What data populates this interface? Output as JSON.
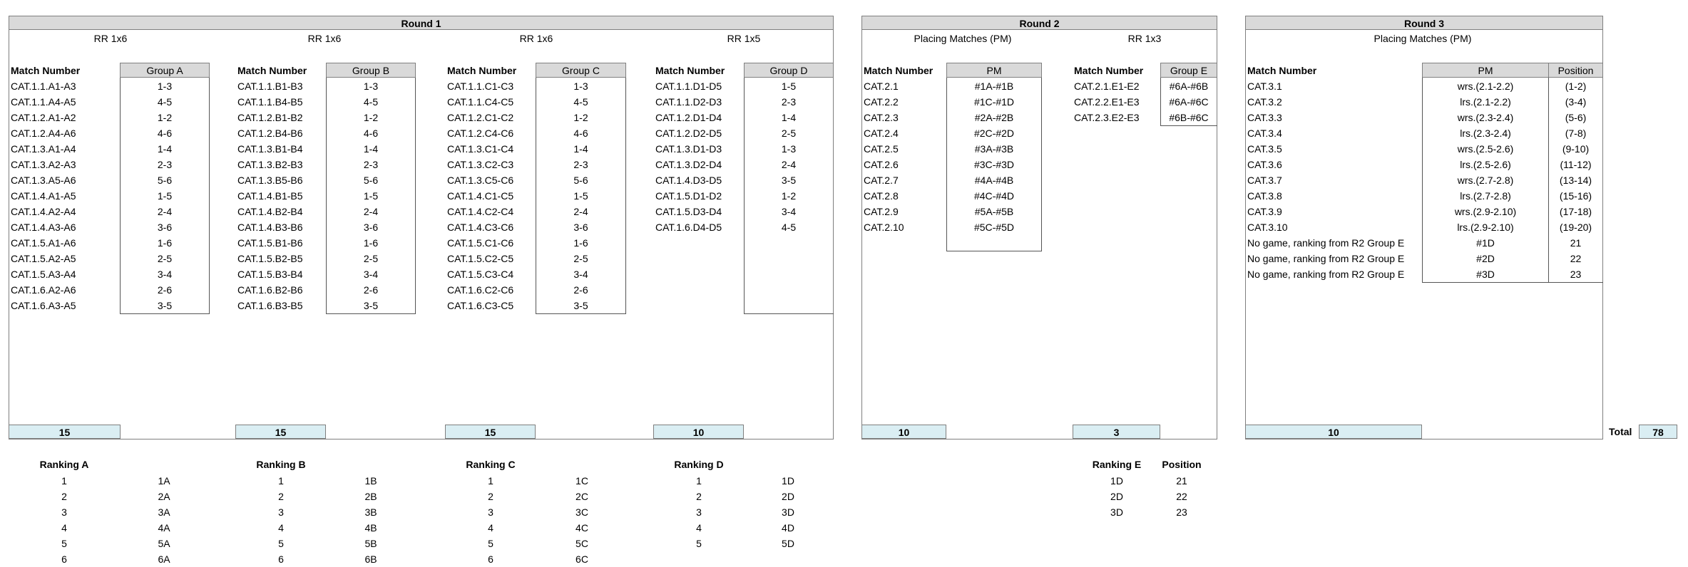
{
  "round1": {
    "title": "Round 1",
    "groups": [
      {
        "subtitle": "RR 1x6",
        "match_header": "Match Number",
        "group_header": "Group A",
        "matches": [
          "CAT.1.1.A1-A3",
          "CAT.1.1.A4-A5",
          "CAT.1.2.A1-A2",
          "CAT.1.2.A4-A6",
          "CAT.1.3.A1-A4",
          "CAT.1.3.A2-A3",
          "CAT.1.3.A5-A6",
          "CAT.1.4.A1-A5",
          "CAT.1.4.A2-A4",
          "CAT.1.4.A3-A6",
          "CAT.1.5.A1-A6",
          "CAT.1.5.A2-A5",
          "CAT.1.5.A3-A4",
          "CAT.1.6.A2-A6",
          "CAT.1.6.A3-A5"
        ],
        "pairs": [
          "1-3",
          "4-5",
          "1-2",
          "4-6",
          "1-4",
          "2-3",
          "5-6",
          "1-5",
          "2-4",
          "3-6",
          "1-6",
          "2-5",
          "3-4",
          "2-6",
          "3-5"
        ],
        "total": "15",
        "ranking_header": "Ranking A",
        "ranks": [
          "1",
          "2",
          "3",
          "4",
          "5",
          "6"
        ],
        "rank_codes": [
          "1A",
          "2A",
          "3A",
          "4A",
          "5A",
          "6A"
        ]
      },
      {
        "subtitle": "RR 1x6",
        "match_header": "Match Number",
        "group_header": "Group B",
        "matches": [
          "CAT.1.1.B1-B3",
          "CAT.1.1.B4-B5",
          "CAT.1.2.B1-B2",
          "CAT.1.2.B4-B6",
          "CAT.1.3.B1-B4",
          "CAT.1.3.B2-B3",
          "CAT.1.3.B5-B6",
          "CAT.1.4.B1-B5",
          "CAT.1.4.B2-B4",
          "CAT.1.4.B3-B6",
          "CAT.1.5.B1-B6",
          "CAT.1.5.B2-B5",
          "CAT.1.5.B3-B4",
          "CAT.1.6.B2-B6",
          "CAT.1.6.B3-B5"
        ],
        "pairs": [
          "1-3",
          "4-5",
          "1-2",
          "4-6",
          "1-4",
          "2-3",
          "5-6",
          "1-5",
          "2-4",
          "3-6",
          "1-6",
          "2-5",
          "3-4",
          "2-6",
          "3-5"
        ],
        "total": "15",
        "ranking_header": "Ranking B",
        "ranks": [
          "1",
          "2",
          "3",
          "4",
          "5",
          "6"
        ],
        "rank_codes": [
          "1B",
          "2B",
          "3B",
          "4B",
          "5B",
          "6B"
        ]
      },
      {
        "subtitle": "RR 1x6",
        "match_header": "Match Number",
        "group_header": "Group C",
        "matches": [
          "CAT.1.1.C1-C3",
          "CAT.1.1.C4-C5",
          "CAT.1.2.C1-C2",
          "CAT.1.2.C4-C6",
          "CAT.1.3.C1-C4",
          "CAT.1.3.C2-C3",
          "CAT.1.3.C5-C6",
          "CAT.1.4.C1-C5",
          "CAT.1.4.C2-C4",
          "CAT.1.4.C3-C6",
          "CAT.1.5.C1-C6",
          "CAT.1.5.C2-C5",
          "CAT.1.5.C3-C4",
          "CAT.1.6.C2-C6",
          "CAT.1.6.C3-C5"
        ],
        "pairs": [
          "1-3",
          "4-5",
          "1-2",
          "4-6",
          "1-4",
          "2-3",
          "5-6",
          "1-5",
          "2-4",
          "3-6",
          "1-6",
          "2-5",
          "3-4",
          "2-6",
          "3-5"
        ],
        "total": "15",
        "ranking_header": "Ranking C",
        "ranks": [
          "1",
          "2",
          "3",
          "4",
          "5",
          "6"
        ],
        "rank_codes": [
          "1C",
          "2C",
          "3C",
          "4C",
          "5C",
          "6C"
        ]
      },
      {
        "subtitle": "RR 1x5",
        "match_header": "Match Number",
        "group_header": "Group D",
        "matches": [
          "CAT.1.1.D1-D5",
          "CAT.1.1.D2-D3",
          "CAT.1.2.D1-D4",
          "CAT.1.2.D2-D5",
          "CAT.1.3.D1-D3",
          "CAT.1.3.D2-D4",
          "CAT.1.4.D3-D5",
          "CAT.1.5.D1-D2",
          "CAT.1.5.D3-D4",
          "CAT.1.6.D4-D5"
        ],
        "pairs": [
          "1-5",
          "2-3",
          "1-4",
          "2-5",
          "1-3",
          "2-4",
          "3-5",
          "1-2",
          "3-4",
          "4-5"
        ],
        "total": "10",
        "ranking_header": "Ranking D",
        "ranks": [
          "1",
          "2",
          "3",
          "4",
          "5"
        ],
        "rank_codes": [
          "1D",
          "2D",
          "3D",
          "4D",
          "5D"
        ]
      }
    ]
  },
  "round2": {
    "title": "Round 2",
    "pm": {
      "subtitle": "Placing Matches (PM)",
      "match_header": "Match Number",
      "group_header": "PM",
      "matches": [
        "CAT.2.1",
        "CAT.2.2",
        "CAT.2.3",
        "CAT.2.4",
        "CAT.2.5",
        "CAT.2.6",
        "CAT.2.7",
        "CAT.2.8",
        "CAT.2.9",
        "CAT.2.10"
      ],
      "pairs": [
        "#1A-#1B",
        "#1C-#1D",
        "#2A-#2B",
        "#2C-#2D",
        "#3A-#3B",
        "#3C-#3D",
        "#4A-#4B",
        "#4C-#4D",
        "#5A-#5B",
        "#5C-#5D"
      ],
      "total": "10"
    },
    "groupE": {
      "subtitle": "RR 1x3",
      "match_header": "Match Number",
      "group_header": "Group E",
      "matches": [
        "CAT.2.1.E1-E2",
        "CAT.2.2.E1-E3",
        "CAT.2.3.E2-E3"
      ],
      "pairs": [
        "#6A-#6B",
        "#6A-#6C",
        "#6B-#6C"
      ],
      "total": "3",
      "ranking_header": "Ranking E",
      "position_header": "Position",
      "ranks": [
        "1D",
        "2D",
        "3D"
      ],
      "positions": [
        "21",
        "22",
        "23"
      ]
    }
  },
  "round3": {
    "title": "Round 3",
    "subtitle": "Placing Matches (PM)",
    "match_header": "Match Number",
    "pm_header": "PM",
    "position_header": "Position",
    "matches": [
      "CAT.3.1",
      "CAT.3.2",
      "CAT.3.3",
      "CAT.3.4",
      "CAT.3.5",
      "CAT.3.6",
      "CAT.3.7",
      "CAT.3.8",
      "CAT.3.9",
      "CAT.3.10",
      "No game, ranking from R2 Group E",
      "No game, ranking from R2 Group E",
      "No game, ranking from R2 Group E"
    ],
    "pm": [
      "wrs.(2.1-2.2)",
      "lrs.(2.1-2.2)",
      "wrs.(2.3-2.4)",
      "lrs.(2.3-2.4)",
      "wrs.(2.5-2.6)",
      "lrs.(2.5-2.6)",
      "wrs.(2.7-2.8)",
      "lrs.(2.7-2.8)",
      "wrs.(2.9-2.10)",
      "lrs.(2.9-2.10)",
      "#1D",
      "#2D",
      "#3D"
    ],
    "positions": [
      "(1-2)",
      "(3-4)",
      "(5-6)",
      "(7-8)",
      "(9-10)",
      "(11-12)",
      "(13-14)",
      "(15-16)",
      "(17-18)",
      "(19-20)",
      "21",
      "22",
      "23"
    ],
    "total": "10"
  },
  "grand_total": {
    "label": "Total",
    "value": "78"
  }
}
